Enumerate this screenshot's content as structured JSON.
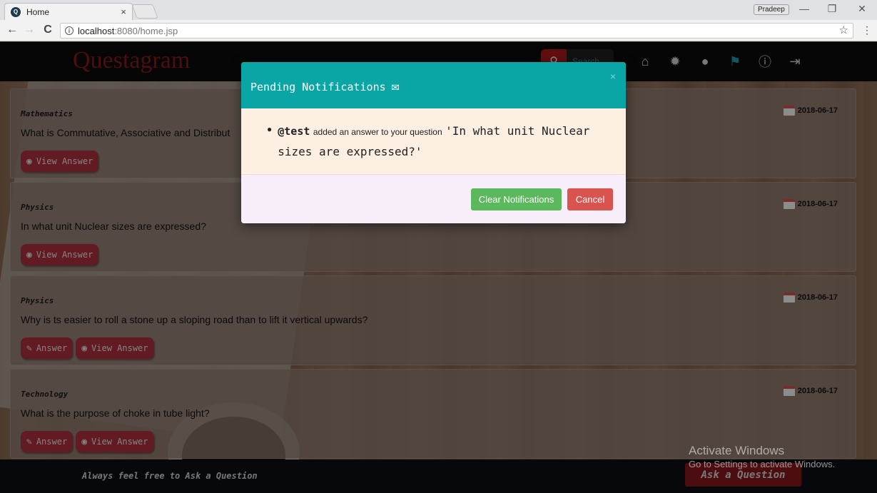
{
  "browser": {
    "tab_title": "Home",
    "tab_close": "×",
    "favicon": "Q",
    "user": "Pradeep",
    "url_host": "localhost",
    "url_path": ":8080/home.jsp",
    "icons": {
      "back": "←",
      "forward": "→",
      "reload": "C",
      "star": "☆",
      "menu": "⋮",
      "minimize": "—",
      "restore": "❐",
      "close": "✕",
      "info": "i"
    }
  },
  "navbar": {
    "brand": "Questagram",
    "search_placeholder": "Search",
    "icons": [
      "home-icon",
      "gear-icon",
      "user-icon",
      "flag-icon",
      "info-icon",
      "logout-icon"
    ],
    "icon_glyphs": [
      "⌂",
      "✹",
      "●",
      "⚑",
      "ⓘ",
      "⇥"
    ]
  },
  "questions": [
    {
      "category": "Mathematics",
      "text": "What is Commutative, Associative and Distribut",
      "date": "2018-06-17",
      "buttons": [
        "View Answer"
      ]
    },
    {
      "category": "Physics",
      "text": "In what unit Nuclear sizes are expressed?",
      "date": "2018-06-17",
      "buttons": [
        "View Answer"
      ]
    },
    {
      "category": "Physics",
      "text": "Why is ts easier to roll a stone up a sloping road than to lift it vertical upwards?",
      "date": "2018-06-17",
      "buttons": [
        "Answer",
        "View Answer"
      ]
    },
    {
      "category": "Technology",
      "text": "What is the purpose of choke in tube light?",
      "date": "2018-06-17",
      "buttons": [
        "Answer",
        "View Answer"
      ]
    }
  ],
  "footer": {
    "tagline": "Always feel free to Ask a Question",
    "ask_button": "Ask a Question"
  },
  "watermark": {
    "line1": "Activate Windows",
    "line2": "Go to Settings to activate Windows."
  },
  "modal": {
    "title": "Pending Notifications",
    "close": "×",
    "notification": {
      "user": "@test",
      "middle": "added an answer to your question",
      "question": "'In what unit Nuclear sizes are expressed?'"
    },
    "clear_button": "Clear Notifications",
    "cancel_button": "Cancel"
  },
  "colors": {
    "modal_header": "#0aa6a6",
    "brand": "#8b1a1a",
    "card_button": "#b3323e",
    "clear_button": "#5cb85c",
    "cancel_button": "#d9534f"
  }
}
